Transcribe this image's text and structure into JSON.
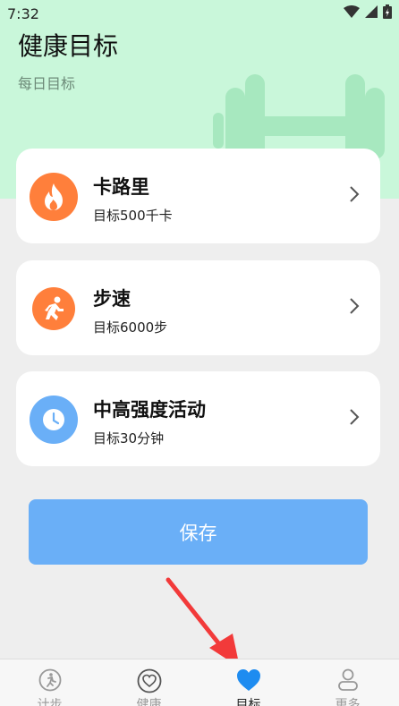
{
  "status": {
    "time": "7:32"
  },
  "header": {
    "title": "健康目标",
    "subtitle": "每日目标"
  },
  "goals": [
    {
      "title": "卡路里",
      "subtitle": "目标500千卡",
      "icon": "flame-icon",
      "color": "#ff7f3b"
    },
    {
      "title": "步速",
      "subtitle": "目标6000步",
      "icon": "running-person-icon",
      "color": "#ff7f3b"
    },
    {
      "title": "中高强度活动",
      "subtitle": "目标30分钟",
      "icon": "clock-icon",
      "color": "#6aaff7"
    }
  ],
  "save_label": "保存",
  "tabs": [
    {
      "label": "计步",
      "icon": "walking-icon",
      "active": false
    },
    {
      "label": "健康",
      "icon": "heart-outline-icon",
      "active": false
    },
    {
      "label": "目标",
      "icon": "heart-filled-icon",
      "active": true
    },
    {
      "label": "更多",
      "icon": "person-icon",
      "active": false
    }
  ],
  "colors": {
    "hero": "#c9f7da",
    "accent": "#1e8cf0",
    "orange": "#ff7f3b",
    "button": "#6aaff7"
  }
}
